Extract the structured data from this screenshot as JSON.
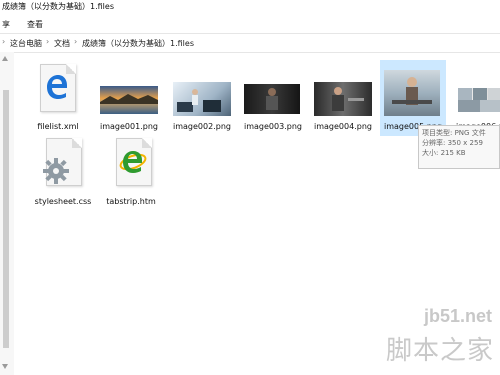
{
  "window": {
    "title": "成绩簿（以分数为基础）1.files"
  },
  "ribbon": {
    "tabs": [
      "享",
      "查看"
    ]
  },
  "address": {
    "crumbs": [
      "这台电脑",
      "文档",
      "成绩簿（以分数为基础）1.files"
    ],
    "separator": "›"
  },
  "files": [
    {
      "name": "filelist.xml",
      "icon": "edge-icon"
    },
    {
      "name": "image001.png",
      "icon": "image-thumbnail"
    },
    {
      "name": "image002.png",
      "icon": "image-thumbnail"
    },
    {
      "name": "image003.png",
      "icon": "image-thumbnail"
    },
    {
      "name": "image004.png",
      "icon": "image-thumbnail"
    },
    {
      "name": "image005.png",
      "icon": "image-thumbnail",
      "selected": true
    },
    {
      "name": "image006.pn",
      "icon": "image-thumbnail"
    },
    {
      "name": "stylesheet.css",
      "icon": "css-gear-icon"
    },
    {
      "name": "tabstrip.htm",
      "icon": "ie-icon"
    }
  ],
  "tooltip": {
    "type": "项目类型: PNG 文件",
    "size_px": "分辨率: 350 x 259",
    "filesize": "大小: 215 KB"
  },
  "watermark": {
    "url": "jb51.net",
    "site": "脚本之家"
  },
  "colors": {
    "selection": "#cce8ff",
    "edge_blue": "#1e73d6",
    "ie_green": "#2f9b2f"
  }
}
